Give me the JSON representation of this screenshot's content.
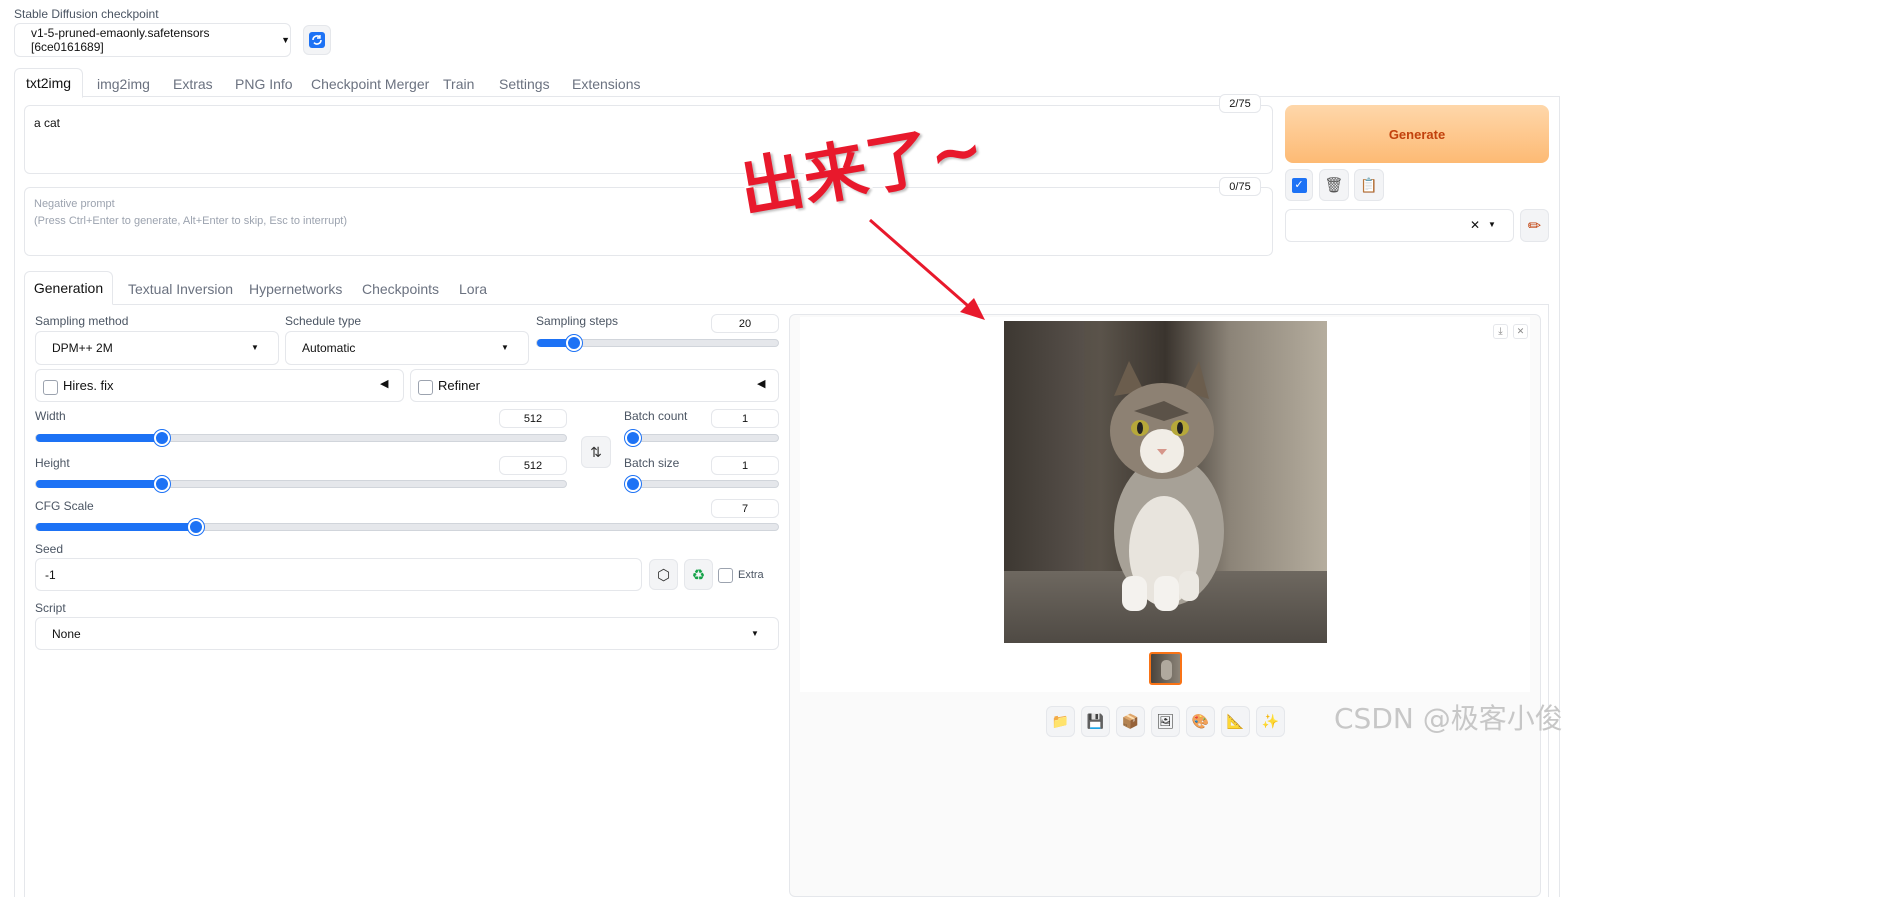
{
  "checkpoint": {
    "label": "Stable Diffusion checkpoint",
    "value": "v1-5-pruned-emaonly.safetensors [6ce0161689]"
  },
  "main_tabs": [
    "txt2img",
    "img2img",
    "Extras",
    "PNG Info",
    "Checkpoint Merger",
    "Train",
    "Settings",
    "Extensions"
  ],
  "prompt": {
    "value": "a cat",
    "token_count": "2/75"
  },
  "negative_prompt": {
    "placeholder_line1": "Negative prompt",
    "placeholder_line2": "(Press Ctrl+Enter to generate, Alt+Enter to skip, Esc to interrupt)",
    "token_count": "0/75"
  },
  "generate_label": "Generate",
  "sub_tabs": [
    "Generation",
    "Textual Inversion",
    "Hypernetworks",
    "Checkpoints",
    "Lora"
  ],
  "sampling_method": {
    "label": "Sampling method",
    "value": "DPM++ 2M"
  },
  "schedule_type": {
    "label": "Schedule type",
    "value": "Automatic"
  },
  "sampling_steps": {
    "label": "Sampling steps",
    "value": "20",
    "fraction": 0.13
  },
  "hires_fix": {
    "label": "Hires. fix"
  },
  "refiner": {
    "label": "Refiner"
  },
  "width": {
    "label": "Width",
    "value": "512",
    "fraction": 0.23
  },
  "height": {
    "label": "Height",
    "value": "512",
    "fraction": 0.23
  },
  "batch_count": {
    "label": "Batch count",
    "value": "1",
    "fraction": 0.0
  },
  "batch_size": {
    "label": "Batch size",
    "value": "1",
    "fraction": 0.0
  },
  "cfg_scale": {
    "label": "CFG Scale",
    "value": "7",
    "fraction": 0.21
  },
  "seed": {
    "label": "Seed",
    "value": "-1",
    "extra_label": "Extra"
  },
  "script": {
    "label": "Script",
    "value": "None"
  },
  "annotation": {
    "text": "出来了~",
    "color": "#e8192c"
  },
  "watermark": "CSDN @极客小俊",
  "colors": {
    "accent": "#1d72f5",
    "generate_bg": "#fdba74",
    "generate_text": "#c2410c",
    "thumb_border": "#f97316"
  }
}
